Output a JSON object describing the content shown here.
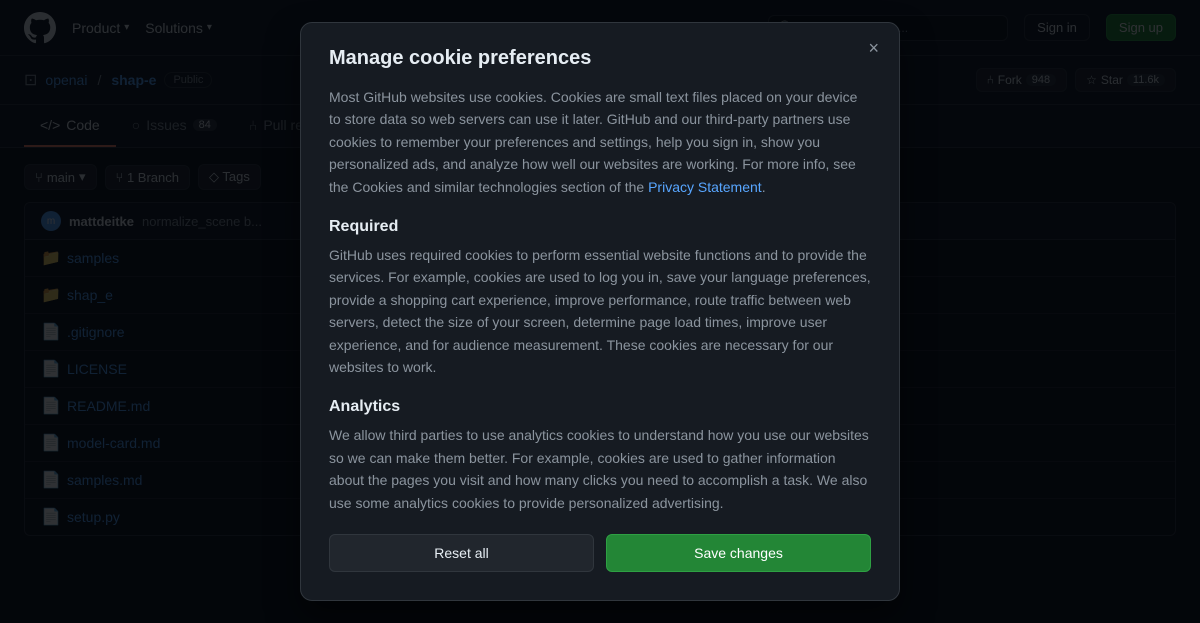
{
  "topnav": {
    "product_label": "Product",
    "solutions_label": "Solutions",
    "search_placeholder": "Search or jump to...",
    "sign_in_label": "Sign in",
    "sign_up_label": "Sign up"
  },
  "repo": {
    "owner": "openai",
    "name": "shap-e",
    "visibility": "Public",
    "fork_label": "Fork",
    "fork_count": "948",
    "star_label": "Star",
    "star_count": "11.6k"
  },
  "tabs": [
    {
      "id": "code",
      "label": "Code",
      "icon": "</>",
      "count": null,
      "active": true
    },
    {
      "id": "issues",
      "label": "Issues",
      "icon": "○",
      "count": "84",
      "active": false
    },
    {
      "id": "pull-requests",
      "label": "Pull requests",
      "icon": "⑃",
      "count": null,
      "active": false
    }
  ],
  "branch_bar": {
    "branch_icon": "⑂",
    "branch_label": "main",
    "branch_count_label": "1 Branch",
    "tags_label": "Tags"
  },
  "commit": {
    "author": "mattdeitke",
    "message": "normalize_scene b...",
    "avatar_initials": "m"
  },
  "files": [
    {
      "type": "folder",
      "name": "samples",
      "commit_msg": ""
    },
    {
      "type": "folder",
      "name": "shap_e",
      "commit_msg": ""
    },
    {
      "type": "file",
      "name": ".gitignore",
      "commit_msg": ""
    },
    {
      "type": "file",
      "name": "LICENSE",
      "commit_msg": ""
    },
    {
      "type": "file",
      "name": "README.md",
      "commit_msg": ""
    },
    {
      "type": "file",
      "name": "model-card.md",
      "commit_msg": ""
    },
    {
      "type": "file",
      "name": "samples.md",
      "commit_msg": ""
    },
    {
      "type": "file",
      "name": "setup.py",
      "commit_msg": ""
    }
  ],
  "modal": {
    "title": "Manage cookie preferences",
    "close_label": "×",
    "intro": "Most GitHub websites use cookies. Cookies are small text files placed on your device to store data so web servers can use it later. GitHub and our third-party partners use cookies to remember your preferences and settings, help you sign in, show you personalized ads, and analyze how well our websites are working. For more info, see the Cookies and similar technologies section of the",
    "privacy_link": "Privacy Statement",
    "intro_end": ".",
    "required_title": "Required",
    "required_body": "GitHub uses required cookies to perform essential website functions and to provide the services. For example, cookies are used to log you in, save your language preferences, provide a shopping cart experience, improve performance, route traffic between web servers, detect the size of your screen, determine page load times, improve user experience, and for audience measurement. These cookies are necessary for our websites to work.",
    "analytics_title": "Analytics",
    "analytics_body": "We allow third parties to use analytics cookies to understand how you use our websites so we can make them better. For example, cookies are used to gather information about the pages you visit and how many clicks you need to accomplish a task. We also use some analytics cookies to provide personalized advertising.",
    "reset_label": "Reset all",
    "save_label": "Save changes"
  }
}
